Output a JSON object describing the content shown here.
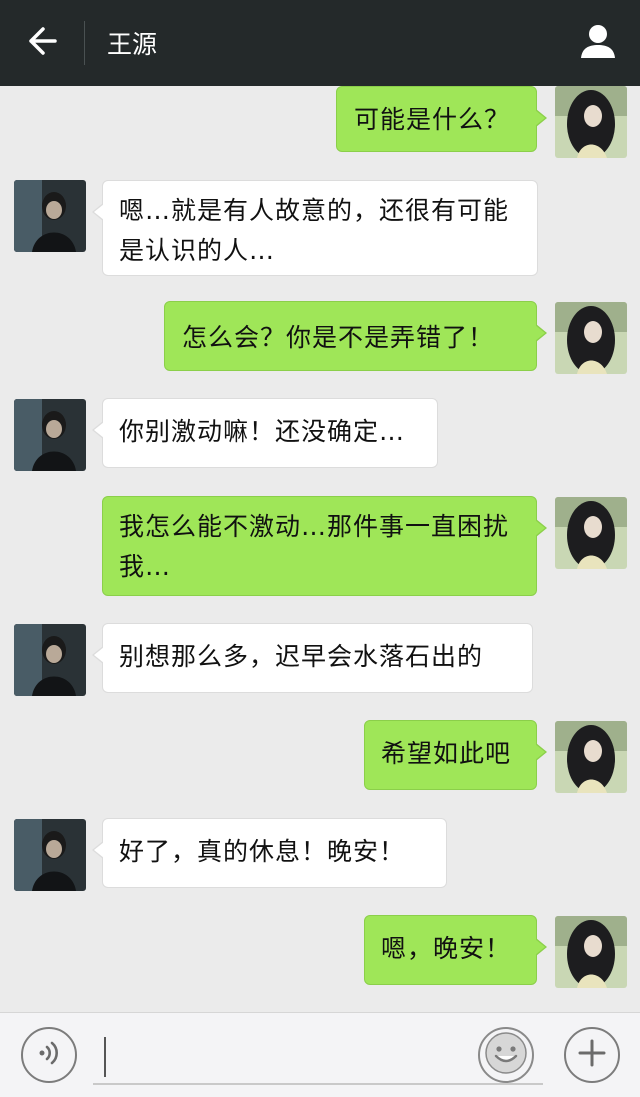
{
  "header": {
    "title": "王源",
    "back_icon": "arrow-left-icon",
    "profile_icon": "user-icon"
  },
  "messages": [
    {
      "side": "out",
      "text": "可能是什么？"
    },
    {
      "side": "in",
      "text": "嗯…就是有人故意的，还很有可能是认识的人…"
    },
    {
      "side": "out",
      "text": "怎么会？你是不是弄错了！"
    },
    {
      "side": "in",
      "text": "你别激动嘛！还没确定…"
    },
    {
      "side": "out",
      "text": "我怎么能不激动…那件事一直困扰我…"
    },
    {
      "side": "in",
      "text": "别想那么多，迟早会水落石出的"
    },
    {
      "side": "out",
      "text": "希望如此吧"
    },
    {
      "side": "in",
      "text": "好了，真的休息！晚安！"
    },
    {
      "side": "out",
      "text": "嗯，晚安！"
    }
  ],
  "input_bar": {
    "voice_icon": "voice-icon",
    "emoji_icon": "emoji-icon",
    "plus_icon": "plus-icon",
    "text_value": ""
  },
  "colors": {
    "header_bg": "#24292a",
    "chat_bg": "#ebebeb",
    "outgoing_bubble": "#9fe658",
    "incoming_bubble": "#ffffff"
  }
}
